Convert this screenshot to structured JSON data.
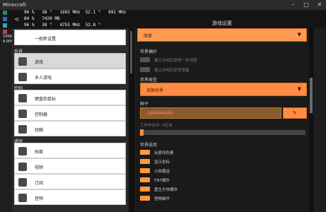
{
  "window": {
    "app_title": "Minecraft",
    "controls": [
      "–",
      "□",
      "✕"
    ]
  },
  "header": {
    "back": "<",
    "title": "游戏设置"
  },
  "overlay": {
    "rows": [
      {
        "color": "#2e8b57",
        "text": "96 %   38 °   1692 MHz  52.1 °   691 MHz"
      },
      {
        "color": "#2a6fbf",
        "text": "84 %   7420 MB"
      },
      {
        "color": "#3aa0d0",
        "text": "96 %   38 °   4755 MHz  52.8 °"
      },
      {
        "color": "#c04040",
        "text": ""
      }
    ],
    "sub1": "10090  5000  386.50",
    "sub2": "9.00%    6.00%"
  },
  "left": {
    "partial_top": "一般新设置",
    "sections": [
      {
        "label": "世界",
        "items": [
          {
            "label": "游戏",
            "icon": "gamepad-icon",
            "selected": true
          },
          {
            "label": "多人游戏",
            "icon": "multiplayer-icon",
            "selected": false
          }
        ]
      },
      {
        "label": "控制",
        "items": [
          {
            "label": "键盘和鼠标",
            "icon": "keyboard-icon",
            "selected": false
          },
          {
            "label": "控制器",
            "icon": "controller-icon",
            "selected": false
          },
          {
            "label": "轻触",
            "icon": "touch-icon",
            "selected": false
          }
        ]
      },
      {
        "label": "通用",
        "items": [
          {
            "label": "档案",
            "icon": "profile-icon",
            "selected": false
          },
          {
            "label": "视频",
            "icon": "monitor-icon",
            "selected": false
          },
          {
            "label": "订阅",
            "icon": "subscription-icon",
            "selected": false
          },
          {
            "label": "音频",
            "icon": "audio-icon",
            "selected": false
          }
        ]
      }
    ]
  },
  "right": {
    "top_dropdown": {
      "value": "简单",
      "caret": "▼"
    },
    "world_prefs": {
      "label": "世界偏好",
      "options": [
        {
          "label": "建立存档后获得一张地图",
          "on": false
        },
        {
          "label": "建立存档后获得宝箱",
          "on": false
        }
      ]
    },
    "world_type": {
      "label": "世界类型",
      "value": "无限世界",
      "caret": "▼"
    },
    "seed": {
      "label": "种子",
      "value": "-1668994203",
      "button": "✎"
    },
    "simulation": {
      "label": "工作中运作: 4区块"
    },
    "world_options": {
      "label": "世界选项",
      "items": [
        {
          "label": "玩家间伤害",
          "state": "on"
        },
        {
          "label": "显示坐标",
          "state": "on"
        },
        {
          "label": "火焰蔓延",
          "state": "on"
        },
        {
          "label": "TNT爆炸",
          "state": "on"
        },
        {
          "label": "重生方块爆炸",
          "state": "on"
        },
        {
          "label": "怪物破坏",
          "state": "on"
        }
      ]
    }
  }
}
